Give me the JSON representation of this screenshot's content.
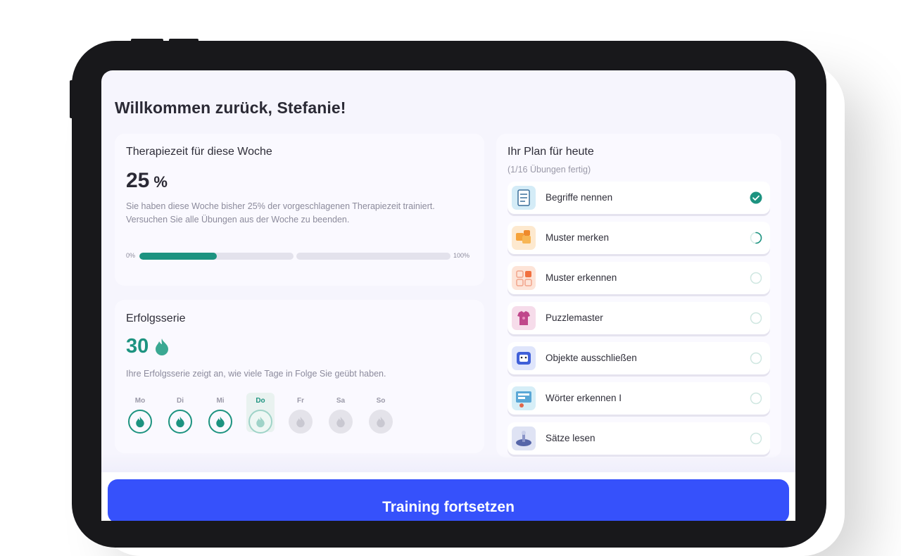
{
  "welcome": "Willkommen zurück, Stefanie!",
  "therapy": {
    "title": "Therapiezeit für diese Woche",
    "value": "25",
    "unit": "%",
    "description_line1": "Sie haben diese Woche bisher 25% der vorgeschlagenen Therapiezeit trainiert.",
    "description_line2": "Versuchen Sie alle Übungen aus der Woche zu beenden.",
    "bar_start_label": "0%",
    "bar_end_label": "100%",
    "progress_fraction": 0.25
  },
  "streak": {
    "title": "Erfolgsserie",
    "value": "30",
    "description": "Ihre Erfolgsserie zeigt an, wie viele Tage in Folge Sie geübt haben.",
    "days": [
      {
        "label": "Mo",
        "state": "done"
      },
      {
        "label": "Di",
        "state": "done"
      },
      {
        "label": "Mi",
        "state": "done"
      },
      {
        "label": "Do",
        "state": "today"
      },
      {
        "label": "Fr",
        "state": "future"
      },
      {
        "label": "Sa",
        "state": "future"
      },
      {
        "label": "So",
        "state": "future"
      }
    ]
  },
  "plan": {
    "title": "Ihr Plan für heute",
    "subtitle": "(1/16 Übungen fertig)",
    "tasks": [
      {
        "label": "Begriffe nennen",
        "status": "done",
        "icon": "list-document-icon"
      },
      {
        "label": "Muster merken",
        "status": "in-progress",
        "icon": "tiles-pattern-icon"
      },
      {
        "label": "Muster erkennen",
        "status": "open",
        "icon": "grid-shapes-icon"
      },
      {
        "label": "Puzzlemaster",
        "status": "open",
        "icon": "puzzle-shirt-icon"
      },
      {
        "label": "Objekte ausschließen",
        "status": "open",
        "icon": "character-face-icon"
      },
      {
        "label": "Wörter erkennen I",
        "status": "open",
        "icon": "words-board-icon"
      },
      {
        "label": "Sätze lesen",
        "status": "open",
        "icon": "reading-scene-icon"
      }
    ]
  },
  "cta_label": "Training fortsetzen",
  "colors": {
    "accent_green": "#1d9380",
    "button_blue": "#3651fb",
    "screen_bg": "#f6f5fd"
  }
}
